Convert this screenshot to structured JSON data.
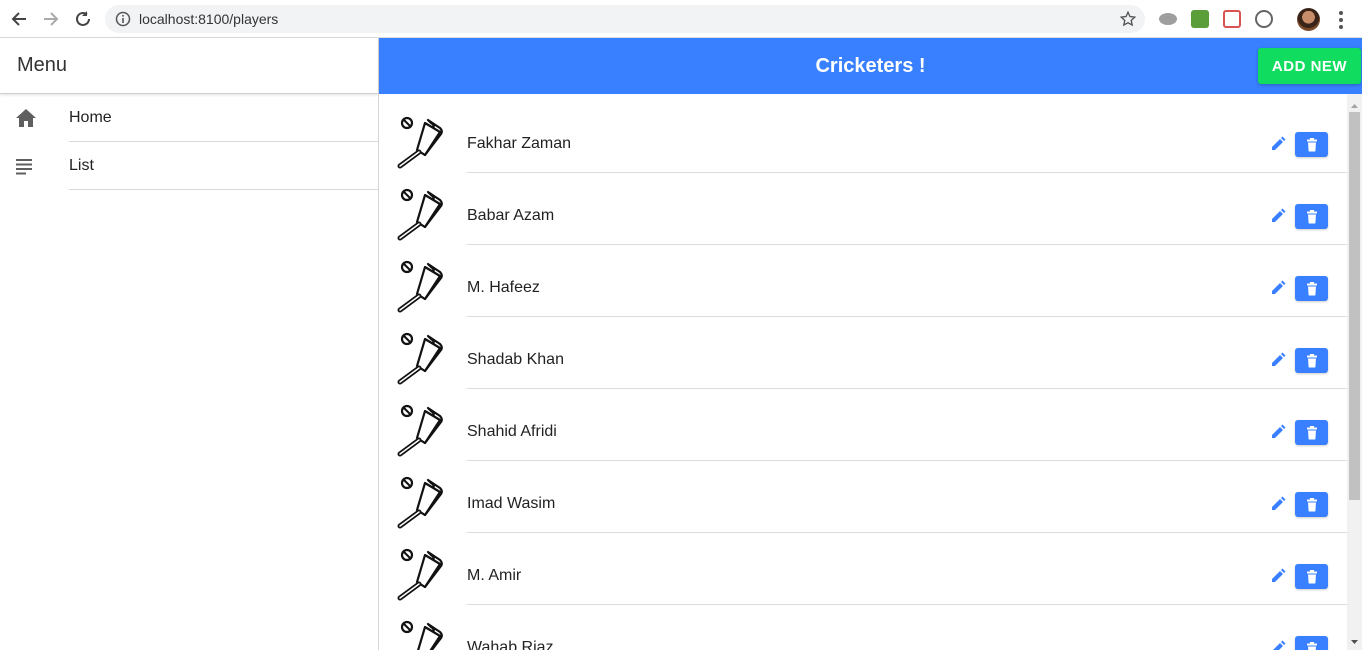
{
  "browser": {
    "url": "localhost:8100/players"
  },
  "menu": {
    "title": "Menu",
    "items": [
      {
        "label": "Home",
        "icon": "home-icon"
      },
      {
        "label": "List",
        "icon": "list-icon"
      }
    ]
  },
  "header": {
    "title": "Cricketers !",
    "add_label": "ADD NEW"
  },
  "players": [
    {
      "name": "Fakhar Zaman"
    },
    {
      "name": "Babar Azam"
    },
    {
      "name": "M. Hafeez"
    },
    {
      "name": "Shadab Khan"
    },
    {
      "name": "Shahid Afridi"
    },
    {
      "name": "Imad Wasim"
    },
    {
      "name": "M. Amir"
    },
    {
      "name": "Wahab Riaz"
    }
  ],
  "colors": {
    "primary": "#3880ff",
    "success": "#10dc60"
  }
}
